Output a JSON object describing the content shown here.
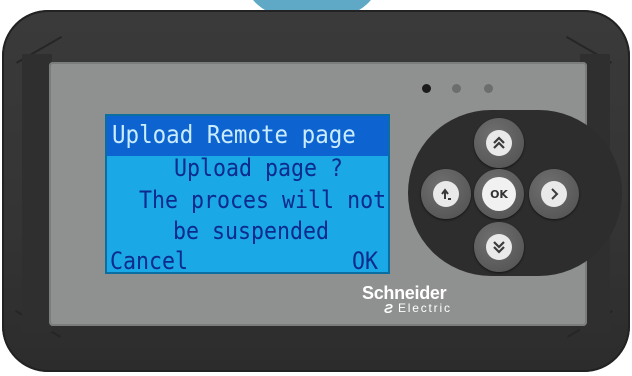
{
  "lcd": {
    "title": "Upload Remote page",
    "line1": "Upload page ?",
    "line2": "The proces will not",
    "line3": "be suspended",
    "softkey_left": "Cancel",
    "softkey_right": "OK"
  },
  "keypad": {
    "ok_label": "OK",
    "icons": {
      "up": "double-chevron-up-icon",
      "down": "double-chevron-down-icon",
      "left": "return-arrow-icon",
      "right": "chevron-right-icon"
    }
  },
  "brand": {
    "name": "Schneider",
    "sub": "Electric",
    "mark": "Ƨ"
  },
  "colors": {
    "lcd_background": "#1aa8e6",
    "lcd_text": "#0c2b8c",
    "title_bar": "#0d63cf",
    "housing": "#3a3a3a",
    "faceplate": "#8f9090"
  }
}
